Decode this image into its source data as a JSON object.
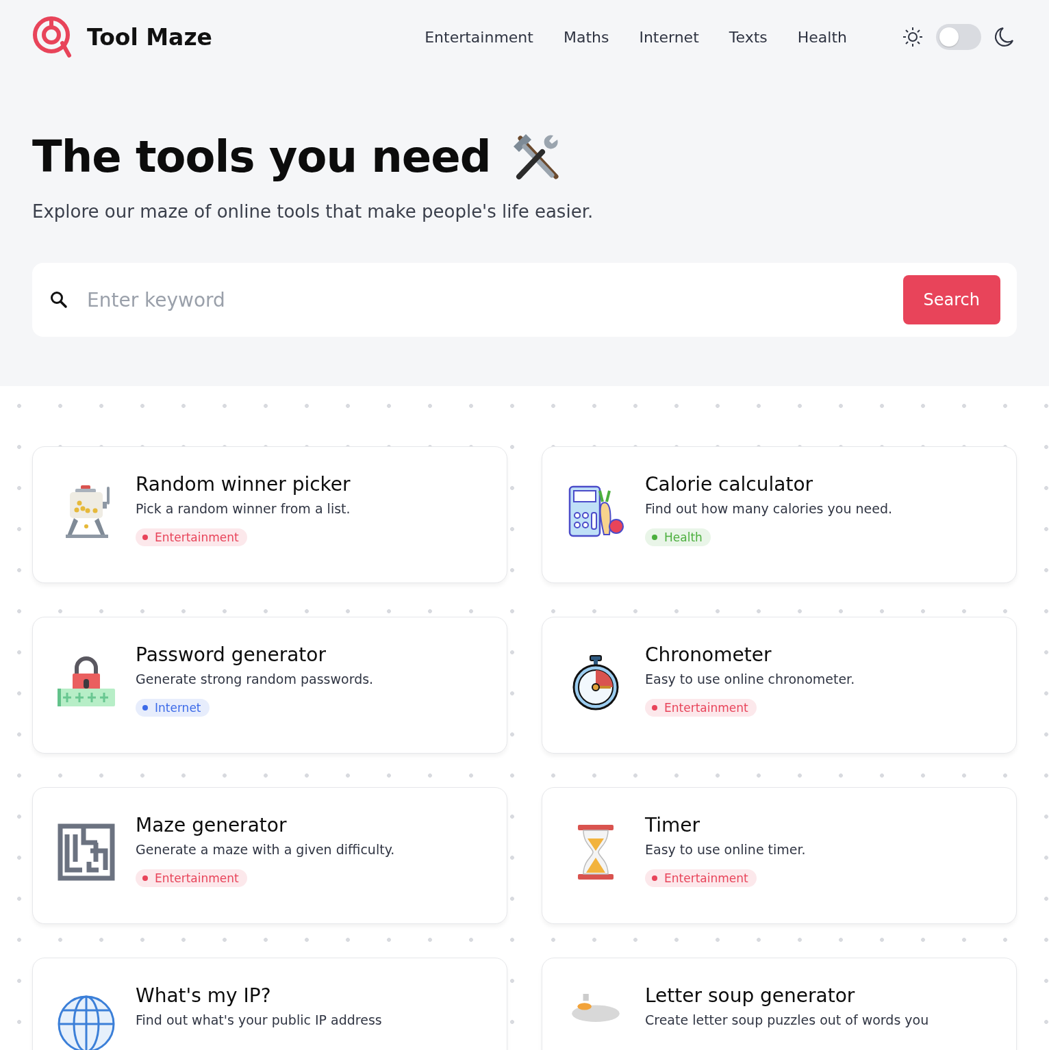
{
  "brand": {
    "name": "Tool Maze"
  },
  "nav": [
    {
      "label": "Entertainment"
    },
    {
      "label": "Maths"
    },
    {
      "label": "Internet"
    },
    {
      "label": "Texts"
    },
    {
      "label": "Health"
    }
  ],
  "theme_toggle": {
    "dark_mode": false
  },
  "hero": {
    "title": "The tools you need",
    "subtitle": "Explore our maze of online tools that make people's life easier."
  },
  "search": {
    "placeholder": "Enter keyword",
    "button": "Search"
  },
  "tools": [
    {
      "title": "Random winner picker",
      "description": "Pick a random winner from a list.",
      "tag": {
        "label": "Entertainment",
        "color": "#e8445a"
      }
    },
    {
      "title": "Calorie calculator",
      "description": "Find out how many calories you need.",
      "tag": {
        "label": "Health",
        "color": "#4caf3e"
      }
    },
    {
      "title": "Password generator",
      "description": "Generate strong random passwords.",
      "tag": {
        "label": "Internet",
        "color": "#3d6be8"
      }
    },
    {
      "title": "Chronometer",
      "description": "Easy to use online chronometer.",
      "tag": {
        "label": "Entertainment",
        "color": "#e8445a"
      }
    },
    {
      "title": "Maze generator",
      "description": "Generate a maze with a given difficulty.",
      "tag": {
        "label": "Entertainment",
        "color": "#e8445a"
      }
    },
    {
      "title": "Timer",
      "description": "Easy to use online timer.",
      "tag": {
        "label": "Entertainment",
        "color": "#e8445a"
      }
    },
    {
      "title": "What's my IP?",
      "description": "Find out what's your public IP address"
    },
    {
      "title": "Letter soup generator",
      "description": "Create letter soup puzzles out of words you"
    }
  ]
}
